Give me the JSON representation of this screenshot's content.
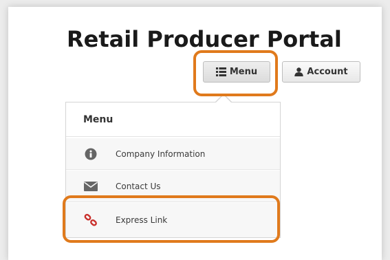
{
  "header": {
    "title": "Retail Producer Portal"
  },
  "toolbar": {
    "menu_label": "Menu",
    "account_label": "Account"
  },
  "dropdown": {
    "heading": "Menu",
    "items": [
      {
        "label": "Company Information",
        "icon": "info-circle-icon"
      },
      {
        "label": "Contact Us",
        "icon": "envelope-icon"
      },
      {
        "label": "Express Link",
        "icon": "link-icon"
      }
    ]
  },
  "colors": {
    "highlight": "#e07a1c",
    "link_icon": "#c9302c",
    "icon_gray": "#666666"
  }
}
